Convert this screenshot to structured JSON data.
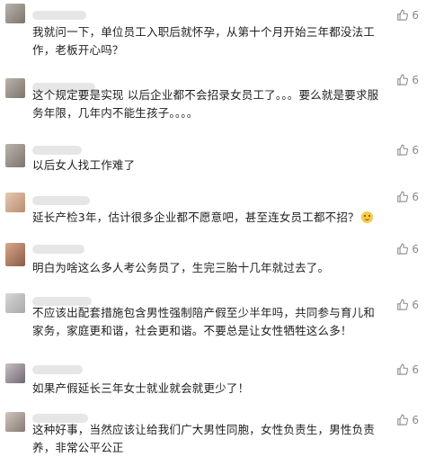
{
  "comments": [
    {
      "text": "我就问一下，单位员工入职后就怀孕，从第十个月开始三年都没法工作，老板开心吗？",
      "likes": "6"
    },
    {
      "text": "这个规定要是实现  以后企业都不会招录女员工了。。。要么就是要求服务年限，几年内不能生孩子。。。。",
      "likes": "6"
    },
    {
      "text": "以后女人找工作难了",
      "likes": "6"
    },
    {
      "text": "延长产检3年，估计很多企业都不愿意吧，甚至连女员工都不招？",
      "likes": "6",
      "emoji": "thinking-emoji"
    },
    {
      "text": "明白为啥这么多人考公务员了，生完三胎十几年就过去了。",
      "likes": "6"
    },
    {
      "text": "不应该出配套措施包含男性强制陪产假至少半年吗，共同参与育儿和家务，家庭更和谐，社会更和谐。不要总是让女性牺牲这么多！",
      "likes": "6"
    },
    {
      "text": "如果产假延长三年女士就业就会就更少了！",
      "likes": "6"
    },
    {
      "text": "这种好事，当然应该让给我们广大男性同胞，女性负责生，男性负责养，非常公平公正",
      "likes": "6"
    }
  ],
  "icons": {
    "like": "thumbs-up-icon"
  }
}
